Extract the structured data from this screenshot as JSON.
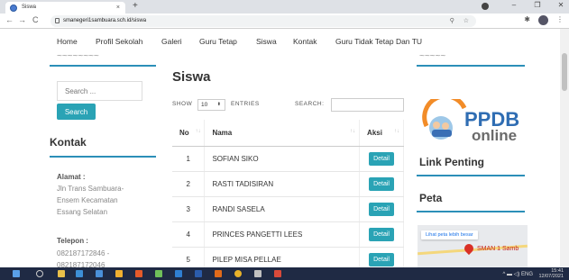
{
  "browser": {
    "tab_title": "Siswa",
    "tab_close": "×",
    "new_tab": "+",
    "url": "smanegeri1sambuara.sch.id/siswa",
    "nav_back": "←",
    "nav_forward": "→",
    "nav_reload": "C",
    "win_minimize": "–",
    "win_restore": "❐",
    "win_close": "✕"
  },
  "topnav": {
    "items": [
      "Home",
      "Profil Sekolah",
      "Galeri",
      "Guru Tetap",
      "Siswa",
      "Kontak",
      "Guru Tidak Tetap Dan TU"
    ]
  },
  "sidebar": {
    "search_placeholder": "Search ...",
    "search_button": "Search",
    "contact_title": "Kontak",
    "alamat_label": "Alamat :",
    "alamat_lines": [
      "Jln Trans Sambuara-",
      "Ensem Kecamatan",
      "Essang Selatan"
    ],
    "telepon_label": "Telepon :",
    "telepon_lines": [
      "082187172846 -",
      "082187172046"
    ]
  },
  "main": {
    "title": "Siswa",
    "show_label": "SHOW",
    "entries_value": "10",
    "entries_label": "ENTRIES",
    "search_label": "SEARCH:",
    "columns": {
      "no": "No",
      "nama": "Nama",
      "aksi": "Aksi"
    },
    "rows": [
      {
        "no": "1",
        "nama": "SOFIAN SIKO",
        "aksi": "Detail"
      },
      {
        "no": "2",
        "nama": "RASTI TADISIRAN",
        "aksi": "Detail"
      },
      {
        "no": "3",
        "nama": "RANDI SASELA",
        "aksi": "Detail"
      },
      {
        "no": "4",
        "nama": "PRINCES PANGETTI LEES",
        "aksi": "Detail"
      },
      {
        "no": "5",
        "nama": "PILEP MISA PELLAE",
        "aksi": "Detail"
      }
    ]
  },
  "right": {
    "logo_text_top": "PPDB",
    "logo_text_bottom": "online",
    "link_penting_title": "Link Penting",
    "peta_title": "Peta",
    "map_link": "Lihat peta lebih besar",
    "map_label": "SMAN 1 Samb"
  },
  "taskbar": {
    "tray": "ENG",
    "time": "15:41",
    "date": "12/07/2021"
  },
  "colors": {
    "accent": "#2aa3b5",
    "divider": "#2c8fb8",
    "taskbar": "#1f2a44"
  }
}
